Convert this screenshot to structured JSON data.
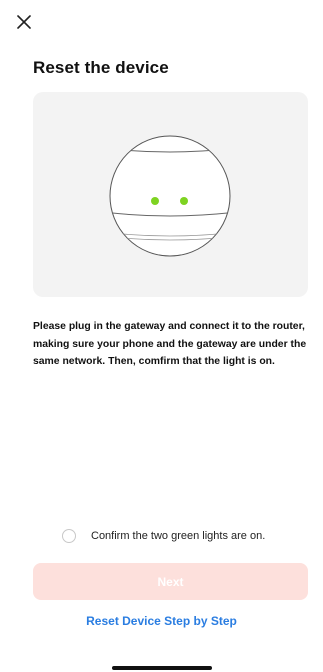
{
  "header": {
    "close_icon": "close-icon"
  },
  "page": {
    "title": "Reset the device"
  },
  "illustration": {
    "description_icon": "gateway-device-icon",
    "light_color": "#7ed321"
  },
  "instructions": {
    "text": "Please plug in the gateway and connect it to the router, making sure your phone and the gateway are under the same network. Then, comfirm that the light is on."
  },
  "confirm": {
    "label": "Confirm the two green lights are on.",
    "checked": false
  },
  "actions": {
    "next_label": "Next",
    "next_enabled": false,
    "next_color": "#fde0dc",
    "step_by_step_label": "Reset Device Step by Step",
    "link_color": "#2a7de1"
  }
}
